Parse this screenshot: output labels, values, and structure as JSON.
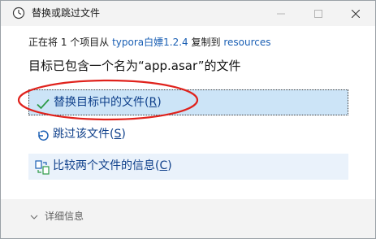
{
  "window": {
    "title": "替换或跳过文件"
  },
  "info": {
    "prefix": "正在将 1 个项目从 ",
    "source": "typora白嫖1.2.4",
    "middle": " 复制到 ",
    "destination": "resources"
  },
  "heading": "目标已包含一个名为“app.asar”的文件",
  "options": {
    "replace": {
      "label": "替换目标中的文件(",
      "key": "R",
      "end": ")"
    },
    "skip": {
      "label": "跳过该文件(",
      "key": "S",
      "end": ")"
    },
    "compare": {
      "label": "比较两个文件的信息(",
      "key": "C",
      "end": ")"
    }
  },
  "footer": {
    "details_label": "详细信息"
  },
  "colors": {
    "accent_link": "#1a5fb4",
    "option_text": "#0e3f8a",
    "annotation_red": "#e0221c",
    "check_green": "#2c9a46"
  }
}
